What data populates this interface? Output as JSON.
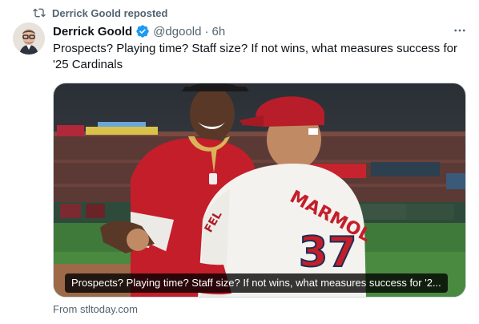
{
  "repost": {
    "text": "Derrick Goold reposted",
    "icon": "repost-icon"
  },
  "author": {
    "display_name": "Derrick Goold",
    "handle": "@dgoold",
    "separator": "·",
    "time": "6h",
    "verified_color": "#1d9bf0",
    "avatar": "avatar"
  },
  "tweet": {
    "text": "Prospects? Playing time? Staff size? If not wins, what measures success for '25 Cardinals"
  },
  "media": {
    "caption": "Prospects? Playing time? Staff size? If not wins, what measures success for '2...",
    "jersey_name": "MARMOL",
    "jersey_number": "37",
    "jersey_logo": "FEL"
  },
  "link": {
    "source": "From stltoday.com"
  },
  "colors": {
    "accent": "#1d9bf0",
    "muted": "#536471",
    "text": "#0f1419",
    "cardinals_red": "#c41e3a"
  },
  "icons": [
    "repost-icon",
    "verified-icon",
    "more-icon"
  ]
}
